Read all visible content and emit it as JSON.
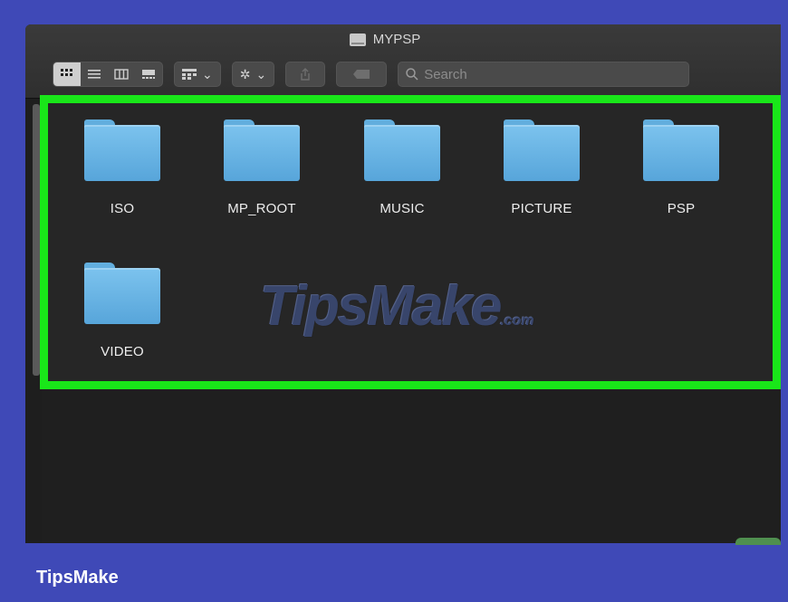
{
  "window": {
    "title": "MYPSP"
  },
  "toolbar": {
    "view_buttons": [
      "icon-view",
      "list-view",
      "column-view",
      "gallery-view"
    ],
    "group_chevron": "⌄",
    "action_chevron": "⌄",
    "search_placeholder": "Search"
  },
  "folders": [
    {
      "label": "ISO"
    },
    {
      "label": "MP_ROOT"
    },
    {
      "label": "MUSIC"
    },
    {
      "label": "PICTURE"
    },
    {
      "label": "PSP"
    },
    {
      "label": "VIDEO"
    }
  ],
  "watermark": {
    "text": "TipsMake",
    "suffix": ".com"
  },
  "footer": {
    "brand": "TipsMake"
  },
  "colors": {
    "background": "#3f49b7",
    "highlight": "#19e619",
    "folder": "#6eb8e8"
  }
}
